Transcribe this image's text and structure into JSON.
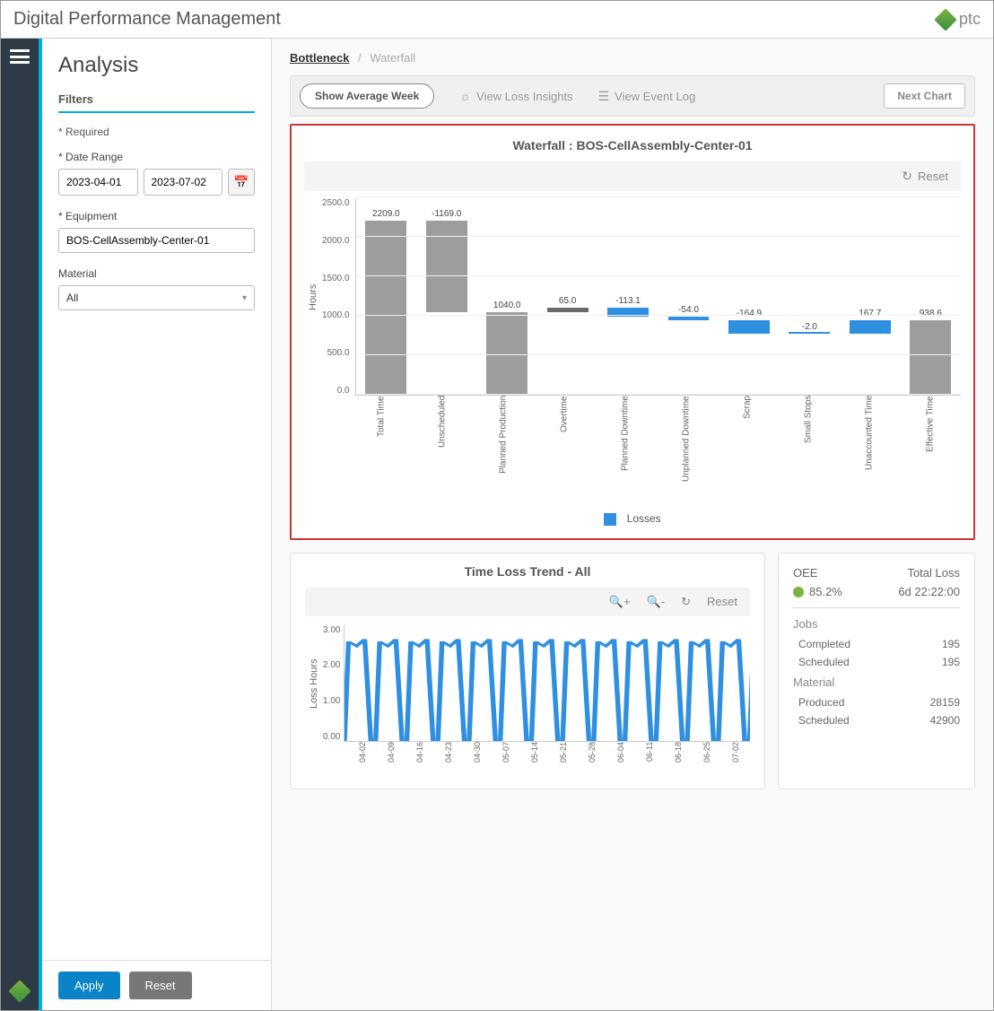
{
  "app": {
    "title": "Digital Performance Management",
    "logo_text": "ptc"
  },
  "sidebar": {
    "title": "Analysis",
    "filters_header": "Filters",
    "required_note": "* Required",
    "date_range_label": "* Date Range",
    "date_from": "2023-04-01",
    "date_to": "2023-07-02",
    "equipment_label": "* Equipment",
    "equipment_value": "BOS-CellAssembly-Center-01",
    "material_label": "Material",
    "material_value": "All",
    "apply": "Apply",
    "reset": "Reset"
  },
  "breadcrumb": {
    "root": "Bottleneck",
    "current": "Waterfall"
  },
  "toolbar": {
    "show_avg": "Show Average Week",
    "loss_insights": "View Loss Insights",
    "event_log": "View Event Log",
    "next_chart": "Next Chart"
  },
  "waterfall": {
    "title": "Waterfall : BOS-CellAssembly-Center-01",
    "reset": "Reset",
    "y_label": "Hours",
    "legend": "Losses"
  },
  "trend": {
    "title": "Time Loss Trend - All",
    "reset": "Reset",
    "y_label": "Loss Hours"
  },
  "stats": {
    "oee_label": "OEE",
    "oee_value": "85.2%",
    "total_loss_label": "Total Loss",
    "total_loss_value": "6d 22:22:00",
    "jobs_header": "Jobs",
    "jobs_completed_label": "Completed",
    "jobs_completed_value": "195",
    "jobs_scheduled_label": "Scheduled",
    "jobs_scheduled_value": "195",
    "material_header": "Material",
    "material_produced_label": "Produced",
    "material_produced_value": "28159",
    "material_scheduled_label": "Scheduled",
    "material_scheduled_value": "42900"
  },
  "chart_data": [
    {
      "type": "bar",
      "title": "Waterfall : BOS-CellAssembly-Center-01",
      "ylabel": "Hours",
      "ylim": [
        0,
        2500
      ],
      "y_ticks": [
        0.0,
        500.0,
        1000.0,
        1500.0,
        2000.0,
        2500.0
      ],
      "legend": [
        "Losses"
      ],
      "categories": [
        "Total Time",
        "Unscheduled",
        "Planned Production",
        "Overtime",
        "Planned Downtime",
        "Unplanned Downtime",
        "Scrap",
        "Small Stops",
        "Unaccounted Time",
        "Effective Time"
      ],
      "values": [
        2209.0,
        -1169.0,
        1040.0,
        65.0,
        -113.1,
        -54.0,
        -164.9,
        -2.0,
        167.7,
        938.6
      ],
      "waterfall_cumulative": [
        2209.0,
        1040.0,
        1040.0,
        1105.0,
        991.9,
        937.9,
        773.0,
        771.0,
        938.7,
        938.6
      ],
      "display_labels": [
        "2209.0",
        "-1169.0",
        "1040.0",
        "65.0",
        "-113.1",
        "-54.0",
        "-164.9",
        "-2.0",
        "167.7",
        "938.6"
      ],
      "series_color": [
        "gray",
        "gray",
        "gray",
        "darkgray",
        "blue",
        "blue",
        "blue",
        "blue",
        "blue",
        "gray"
      ]
    },
    {
      "type": "line",
      "title": "Time Loss Trend - All",
      "ylabel": "Loss Hours",
      "ylim": [
        0,
        3
      ],
      "y_ticks": [
        0.0,
        1.0,
        2.0,
        3.0
      ],
      "x": [
        "04-02",
        "04-09",
        "04-16",
        "04-23",
        "04-30",
        "05-07",
        "05-14",
        "05-21",
        "05-28",
        "06-04",
        "06-11",
        "06-18",
        "06-25",
        "07-02"
      ]
    }
  ]
}
